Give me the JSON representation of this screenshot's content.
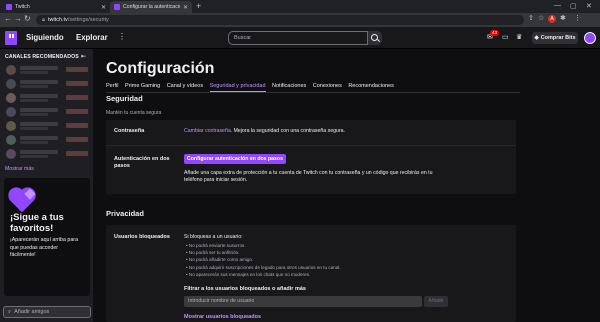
{
  "browser": {
    "tabs": [
      {
        "label": "Twitch",
        "active": false
      },
      {
        "label": "Configurar la autenticación en d...",
        "active": true
      }
    ],
    "url_host": "twitch.tv",
    "url_path": "/settings/security",
    "profile_initial": "A"
  },
  "topnav": {
    "following": "Siguiendo",
    "explore": "Explorar",
    "more": "⋮",
    "search_placeholder": "Buscar",
    "notifications_count": "43",
    "buy_bits": "Comprar Bits"
  },
  "sidebar": {
    "title": "CANALES RECOMENDADOS",
    "show_more": "Mostrar más",
    "promo_title": "¡Sigue a tus favoritos!",
    "promo_text": "¡Aparecerán aquí arriba para que puedas acceder fácilmente!",
    "add_friends": "Añadir amigos"
  },
  "page": {
    "title": "Configuración",
    "tabs": [
      "Perfil",
      "Prime Gaming",
      "Canal y vídeos",
      "Seguridad y privacidad",
      "Notificaciones",
      "Conexiones",
      "Recomendaciones"
    ],
    "selected_tab": "Seguridad y privacidad"
  },
  "security": {
    "title": "Seguridad",
    "subtitle": "Mantén tu cuenta segura",
    "password_label": "Contraseña",
    "password_link": "Cambiar contraseña.",
    "password_text": " Mejora la seguridad con una contraseña segura.",
    "twofa_label": "Autenticación en dos pasos",
    "twofa_button": "Configurar autenticación en dos pasos",
    "twofa_text": "Añade una capa extra de protección a tu cuenta de Twitch con tu contraseña y un código que recibirás en tu teléfono para iniciar sesión."
  },
  "privacy": {
    "title": "Privacidad",
    "blocked_label": "Usuarios bloqueados",
    "blocked_intro": "Si bloqueas a un usuario:",
    "blocked_bullets": [
      "No podrá enviarte susurros.",
      "No podrá ser tu anfitrión.",
      "No podrá añadirte como amigo.",
      "No podrá adquirir suscripciones de legado para otros usuarios en tu canal.",
      "No aparecerán sus mensajes en los chats que no moderes."
    ],
    "filter_label": "Filtrar a los usuarios bloqueados o añadir más",
    "filter_placeholder": "Introducir nombre de usuario",
    "add_button": "Añadir",
    "show_blocked": "Mostrar usuarios bloqueados"
  },
  "colors": {
    "accent": "#9147ff",
    "accent_light": "#bf94ff",
    "bg": "#0e0e10",
    "panel": "#18181b"
  }
}
